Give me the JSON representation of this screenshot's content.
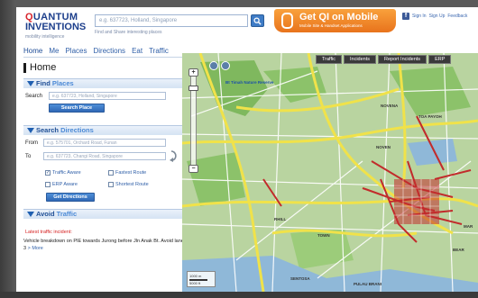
{
  "header": {
    "logo_line1_a": "Q",
    "logo_line1_b": "UANTUM",
    "logo_line2": "INVENTIONS",
    "logo_tagline": "mobility intelligence",
    "search_placeholder": "e.g. 637723, Holland, Singapore",
    "search_sub": "Find and Share interesting places",
    "mobile_title": "Get QI on Mobile",
    "mobile_sub": "Mobile Site & Handset Applications",
    "links": [
      "Sign In",
      "Sign Up",
      "Feedback"
    ]
  },
  "nav": {
    "items": [
      "Home",
      "Me",
      "Places",
      "Directions",
      "Eat",
      "Traffic"
    ]
  },
  "page": {
    "title": "Home"
  },
  "find_places": {
    "title_a": "Find",
    "title_b": "Places",
    "search_label": "Search",
    "search_placeholder": "e.g. 637723, Holland, Singapore",
    "button": "Search Place"
  },
  "search_directions": {
    "title_a": "Search",
    "title_b": "Directions",
    "from_label": "From",
    "from_placeholder": "e.g. 575701, Orchard Road, Funan",
    "to_label": "To",
    "to_placeholder": "e.g. 637723, Changi Road, Singapore",
    "options": [
      {
        "label": "Traffic Aware",
        "checked": true
      },
      {
        "label": "Fastest Route",
        "checked": false
      },
      {
        "label": "ERP Aware",
        "checked": false
      },
      {
        "label": "Shortest Route",
        "checked": false
      }
    ],
    "button": "Get Directions"
  },
  "avoid_traffic": {
    "title_a": "Avoid",
    "title_b": "Traffic",
    "latest_label": "Latest traffic incident:",
    "message": "Vehicle breakdown on PIE towards Jurong before Jln Anak Bt. Avoid lane 3",
    "more": "> More"
  },
  "map": {
    "tabs": [
      "Traffic",
      "Incidents",
      "Report Incidents",
      "ERP"
    ],
    "zoom_plus": "+",
    "zoom_minus": "−",
    "scale_label": "1000 m",
    "scale_label2": "5000 ft",
    "labels": [
      {
        "text": "Bt Timah Nature Reserve"
      },
      {
        "text": "NOVENA"
      },
      {
        "text": "TOA PAYOH"
      },
      {
        "text": "NOVEN"
      },
      {
        "text": "RHILL"
      },
      {
        "text": "TOWN"
      },
      {
        "text": "SENTOSA"
      },
      {
        "text": "BEAR"
      },
      {
        "text": "MAR"
      },
      {
        "text": "PULAU BRANI"
      }
    ],
    "colors": {
      "land": "#b9d4a0",
      "park": "#7fb85e",
      "water": "#8fb8d8",
      "expressway": "#f0e24a",
      "congested": "#c22b2b",
      "road": "#ffffff"
    }
  }
}
